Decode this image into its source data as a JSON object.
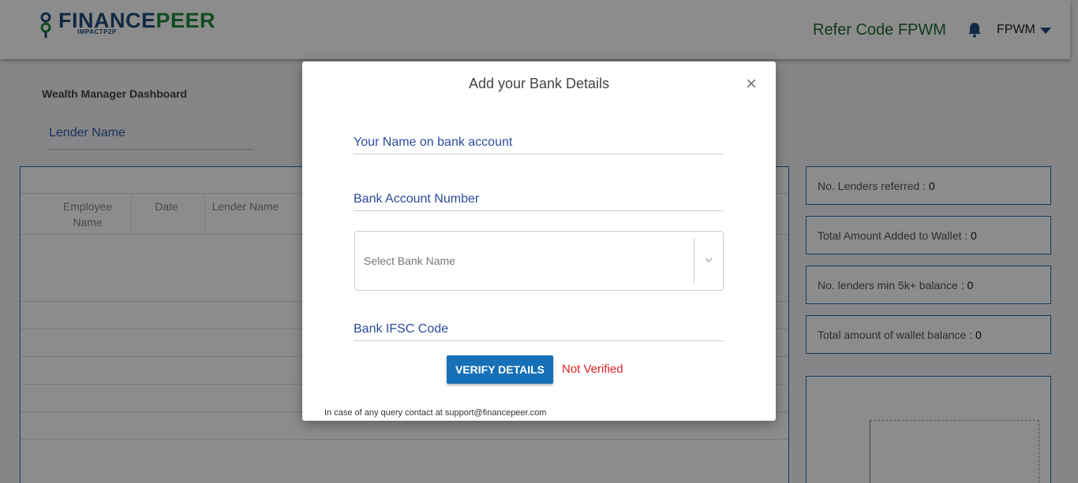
{
  "header": {
    "logo_primary": "FINANCE",
    "logo_secondary": "PEER",
    "logo_sub": "IMPACTP2P",
    "refer_code": "Refer Code FPWM",
    "user_name": "FPWM",
    "brand_color": "#1f4e79",
    "accent_green": "#1f8a3b"
  },
  "page": {
    "title": "Wealth Manager Dashboard",
    "lender_name_label": "Lender Name",
    "table_headers": [
      "Employee Name",
      "Date",
      "Lender Name"
    ]
  },
  "stats": [
    {
      "label": "No. Lenders referred : ",
      "value": "0"
    },
    {
      "label": "Total Amount Added to Wallet : ",
      "value": "0"
    },
    {
      "label": "No. lenders min 5k+ balance : ",
      "value": "0"
    },
    {
      "label": "Total amount of wallet balance : ",
      "value": "0"
    }
  ],
  "modal": {
    "title": "Add your Bank Details",
    "name_placeholder": "Your Name on bank account",
    "account_placeholder": "Bank Account Number",
    "bank_select_placeholder": "Select Bank Name",
    "ifsc_placeholder": "Bank IFSC Code",
    "verify_label": "VERIFY DETAILS",
    "status": "Not Verified",
    "footer": "In case of any query contact at support@financepeer.com",
    "primary_color": "#1570b8",
    "error_color": "#e02020"
  }
}
